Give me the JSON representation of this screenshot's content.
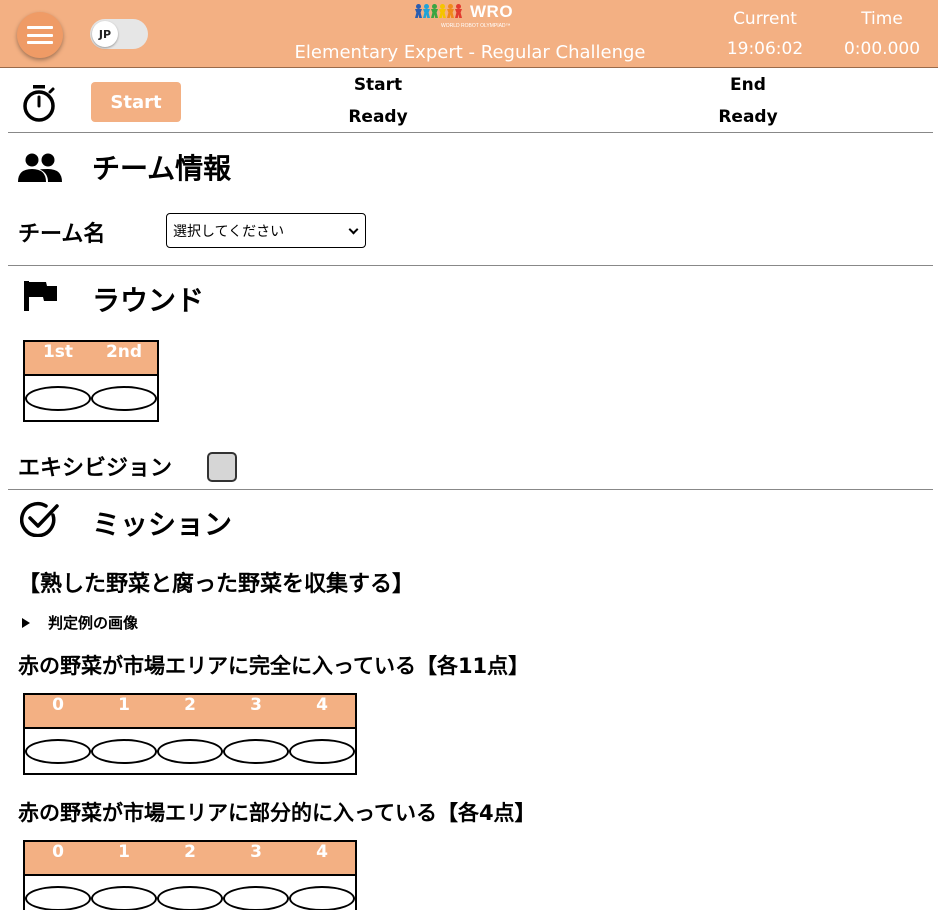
{
  "header": {
    "lang": "JP",
    "logo_text": "WRO",
    "logo_subtext": "WORLD ROBOT OLYMPIAD™",
    "challenge": "Elementary Expert - Regular Challenge",
    "current_label": "Current",
    "time_label": "Time",
    "current_value": "19:06:02",
    "time_value": "0:00.000"
  },
  "timer": {
    "start_button": "Start",
    "start_head": "Start",
    "start_status": "Ready",
    "end_head": "End",
    "end_status": "Ready"
  },
  "team": {
    "title": "チーム情報",
    "name_label": "チーム名",
    "select_placeholder": "選択してください"
  },
  "round": {
    "title": "ラウンド",
    "options": [
      "1st",
      "2nd"
    ],
    "exhibition_label": "エキシビジョン"
  },
  "mission": {
    "title": "ミッション",
    "subtitle": "【熟した野菜と腐った野菜を収集する】",
    "details_label": "判定例の画像",
    "q1": {
      "label": "赤の野菜が市場エリアに完全に入っている【各11点】",
      "options": [
        "0",
        "1",
        "2",
        "3",
        "4"
      ]
    },
    "q2": {
      "label": "赤の野菜が市場エリアに部分的に入っている【各4点】",
      "options": [
        "0",
        "1",
        "2",
        "3",
        "4"
      ]
    }
  },
  "colors": {
    "accent": "#f3b083",
    "menu_button": "#ef9b66"
  }
}
